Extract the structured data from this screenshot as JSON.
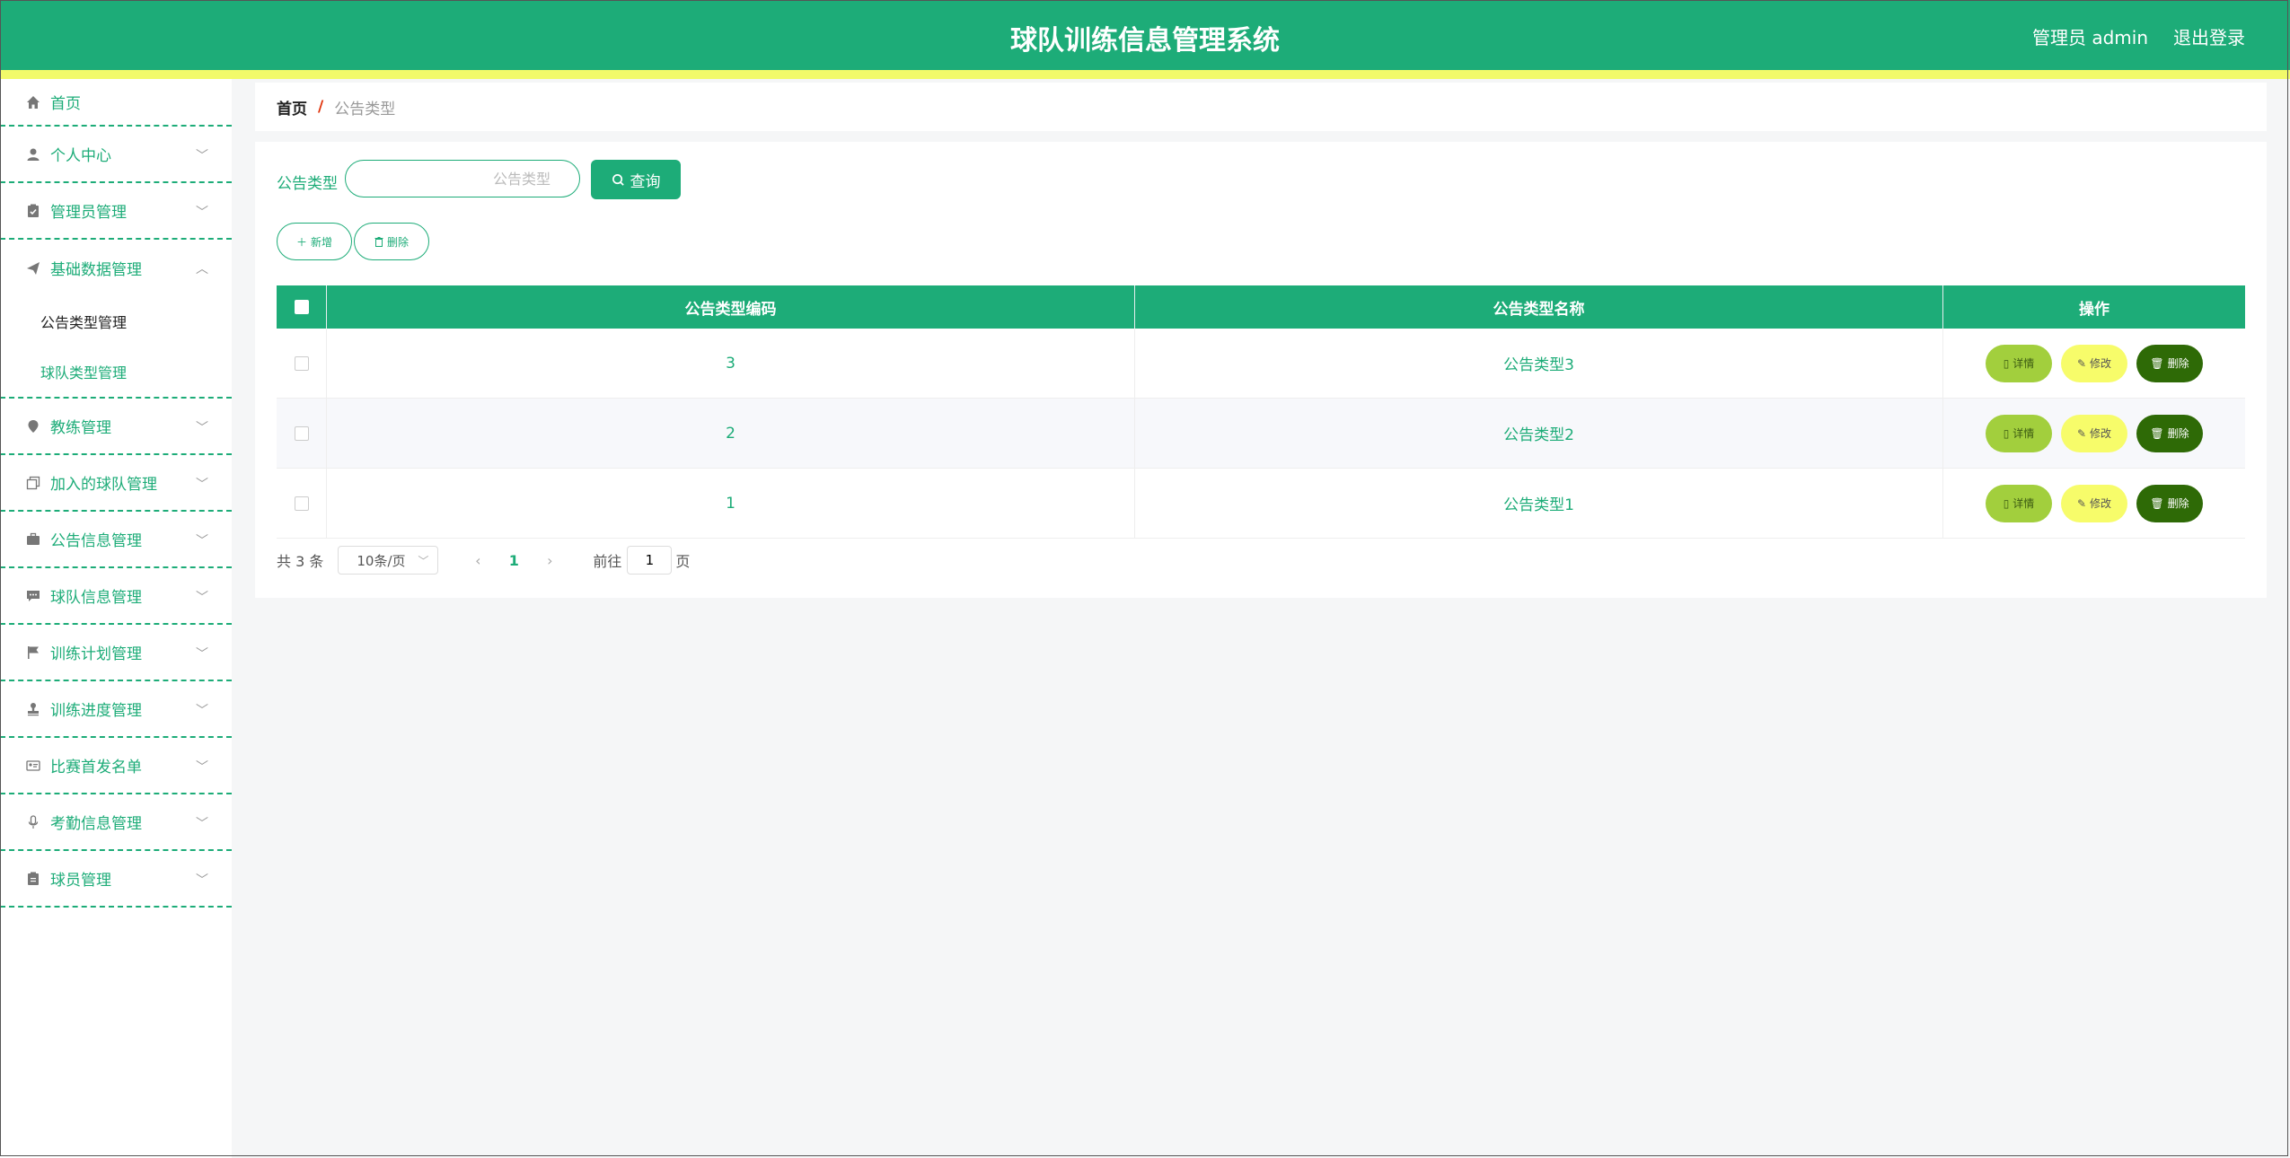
{
  "header": {
    "title": "球队训练信息管理系统",
    "user_label": "管理员 admin",
    "logout_label": "退出登录",
    "bg_color": "#1dac78",
    "strip_color": "#f2fa6a"
  },
  "sidebar": {
    "home": "首页",
    "items": [
      {
        "label": "个人中心",
        "icon": "user-icon"
      },
      {
        "label": "管理员管理",
        "icon": "clipboard-icon"
      },
      {
        "label": "基础数据管理",
        "icon": "paper-plane-icon",
        "expanded": true,
        "children": [
          "公告类型管理",
          "球队类型管理"
        ],
        "active_child": 0
      },
      {
        "label": "教练管理",
        "icon": "location-pin-icon"
      },
      {
        "label": "加入的球队管理",
        "icon": "copy-icon"
      },
      {
        "label": "公告信息管理",
        "icon": "briefcase-icon"
      },
      {
        "label": "球队信息管理",
        "icon": "chat-icon"
      },
      {
        "label": "训练计划管理",
        "icon": "flag-icon"
      },
      {
        "label": "训练进度管理",
        "icon": "stamp-icon"
      },
      {
        "label": "比赛首发名单",
        "icon": "id-card-icon"
      },
      {
        "label": "考勤信息管理",
        "icon": "microphone-icon"
      },
      {
        "label": "球员管理",
        "icon": "clipboard-list-icon"
      }
    ]
  },
  "breadcrumb": {
    "home": "首页",
    "separator": "/",
    "current": "公告类型"
  },
  "search": {
    "label": "公告类型",
    "placeholder": "公告类型",
    "value": "",
    "button_label": "查询"
  },
  "toolbar": {
    "add_label": "新增",
    "delete_label": "删除"
  },
  "table": {
    "headers": [
      "公告类型编码",
      "公告类型名称",
      "操作"
    ],
    "rows": [
      {
        "code": "3",
        "name": "公告类型3"
      },
      {
        "code": "2",
        "name": "公告类型2"
      },
      {
        "code": "1",
        "name": "公告类型1"
      }
    ],
    "actions": {
      "detail": "详情",
      "edit": "修改",
      "delete": "删除"
    }
  },
  "pagination": {
    "total": "共 3 条",
    "page_size": "10条/页",
    "current_page": "1",
    "goto_prefix": "前往",
    "goto_value": "1",
    "goto_suffix": "页"
  }
}
